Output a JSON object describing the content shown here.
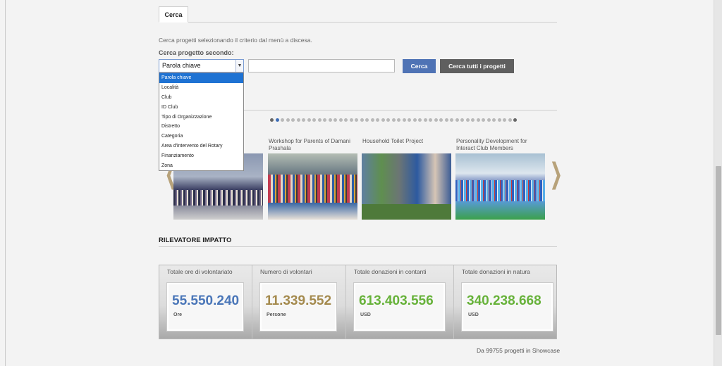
{
  "tabs": [
    {
      "label": "Cerca"
    }
  ],
  "search": {
    "instruction": "Cerca progetti selezionando il criterio dal menù a discesa.",
    "criterion_label": "Cerca progetto secondo:",
    "selected": "Parola chiave",
    "keyword_value": "",
    "options": [
      "Parola chiave",
      "Località",
      "Club",
      "ID Club",
      "Tipo di Organizzazione",
      "Distretto",
      "Categoria",
      "Area d'intervento del Rotary",
      "Finanziamento",
      "Zona"
    ],
    "search_button": "Cerca",
    "search_all_button": "Cerca tutti i progetti"
  },
  "carousel": {
    "dot_count": 47,
    "active_dot": 1,
    "prev_arrow": "❮",
    "next_arrow": "❯",
    "slides": [
      {
        "caption": ""
      },
      {
        "caption": "Workshop for Parents of Damani Prashala"
      },
      {
        "caption": "Household Toilet Project"
      },
      {
        "caption": "Personality Development for Interact Club Members"
      }
    ]
  },
  "impact": {
    "title": "RILEVATORE IMPATTO",
    "stats": [
      {
        "label": "Totale ore di volontariato",
        "value": "55.550.240",
        "unit": "Ore",
        "color": "#4a76b8"
      },
      {
        "label": "Numero di volontari",
        "value": "11.339.552",
        "unit": "Persone",
        "color": "#a48a4e"
      },
      {
        "label": "Totale donazioni in contanti",
        "value": "613.403.556",
        "unit": "USD",
        "color": "#67b23a"
      },
      {
        "label": "Totale donazioni in natura",
        "value": "340.238.668",
        "unit": "USD",
        "color": "#67b23a"
      }
    ],
    "footnote": "Da 99755 progetti in Showcase"
  }
}
